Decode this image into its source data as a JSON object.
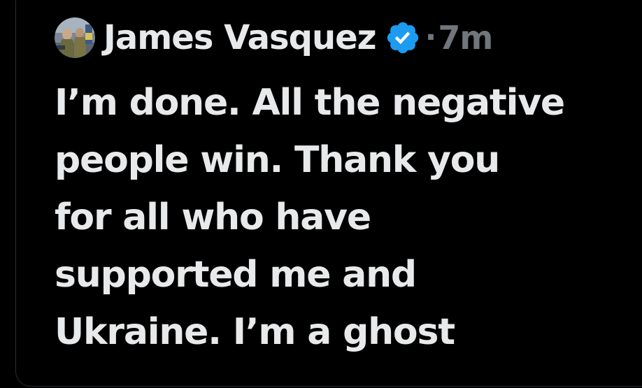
{
  "post": {
    "author_name": "James Vasquez",
    "separator": "·",
    "time": "7m",
    "text_lines": [
      "I’m done. All the negative",
      "people win. Thank you",
      "for all who have",
      "supported me and",
      "Ukraine. I’m a ghost"
    ]
  },
  "icons": {
    "avatar": "profile-photo-avatar",
    "verified": "verified-badge-icon"
  },
  "colors": {
    "background": "#000000",
    "text_primary": "#e7e9ea",
    "text_secondary": "#71767b",
    "verified_blue": "#1d9bf0",
    "panel_border": "#2a2d31"
  }
}
